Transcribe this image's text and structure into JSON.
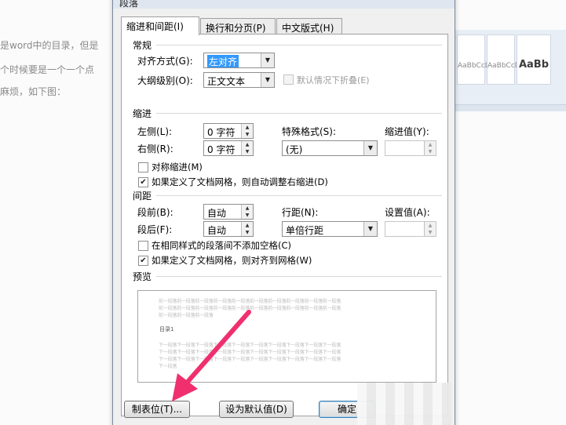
{
  "background": {
    "lines": [
      "是word中的目录，但是",
      "个时候要是一个一个点",
      "麻烦，如下图："
    ],
    "ribbon_styles": [
      "AaBbCcDc",
      "AaBbCcDc",
      "AaBb"
    ]
  },
  "dialog": {
    "title": "段落",
    "tabs": [
      "缩进和间距(I)",
      "换行和分页(P)",
      "中文版式(H)"
    ],
    "general": {
      "title": "常规",
      "alignment_label": "对齐方式(G):",
      "alignment_value": "左对齐",
      "outline_label": "大纲级别(O):",
      "outline_value": "正文文本",
      "collapse_label": "默认情况下折叠(E)"
    },
    "indent": {
      "title": "缩进",
      "left_label": "左侧(L):",
      "left_value": "0 字符",
      "right_label": "右侧(R):",
      "right_value": "0 字符",
      "special_label": "特殊格式(S):",
      "special_value": "(无)",
      "by_label": "缩进值(Y):",
      "mirror_label": "对称缩进(M)",
      "auto_right_label": "如果定义了文档网格，则自动调整右缩进(D)"
    },
    "spacing": {
      "title": "间距",
      "before_label": "段前(B):",
      "before_value": "自动",
      "after_label": "段后(F):",
      "after_value": "自动",
      "line_label": "行距(N):",
      "line_value": "单倍行距",
      "at_label": "设置值(A):",
      "no_space_label": "在相同样式的段落间不添加空格(C)",
      "snap_grid_label": "如果定义了文档网格，则对齐到网格(W)"
    },
    "preview": {
      "title": "预览",
      "prev_lines": [
        "前一段落前一段落前一段落前一段落前一段落前一段落前一段落前一段落前一段落前一段落",
        "前一段落前一段落前一段落前一段落前一段落前一段落前一段落前一段落前一段落前一段落",
        "前一段落前一段落前一段落"
      ],
      "sample": "目录1",
      "next_lines": [
        "下一段落下一段落下一段落下一段落下一段落下一段落下一段落下一段落下一段落下一段落",
        "下一段落下一段落下一段落下一段落下一段落下一段落下一段落下一段落下一段落下一段落",
        "下一段落下一段落下一段落下一段落下一段落下一段落下一段落下一段落下一段落下一段落",
        "下一段落"
      ]
    },
    "buttons": {
      "tabs": "制表位(T)...",
      "set_default": "设为默认值(D)",
      "ok": "确定"
    }
  },
  "colors": {
    "annotation_arrow": "#f0306e",
    "selection": "#3399ff"
  },
  "icons": {
    "dropdown": "chevron-down-icon",
    "spinner": "spin-arrows-icon",
    "checkmark": "checkmark-icon"
  }
}
